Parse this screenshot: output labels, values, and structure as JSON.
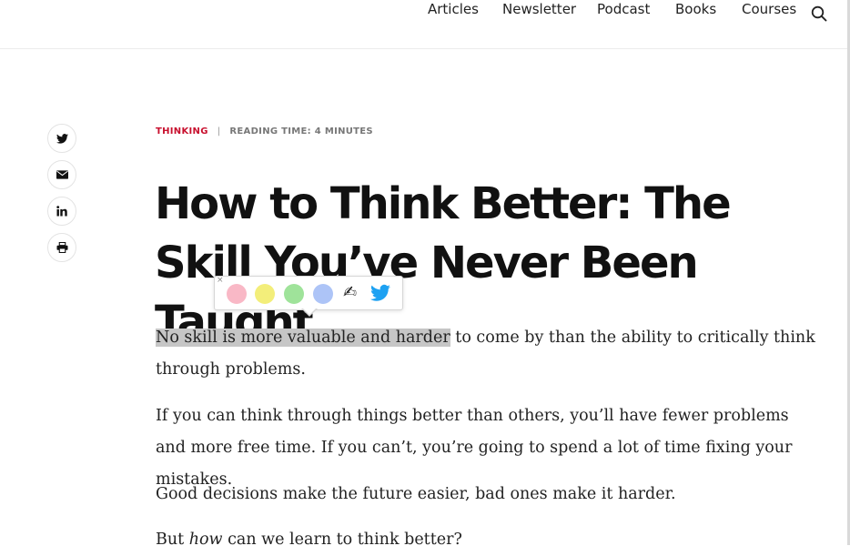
{
  "nav": {
    "items": [
      "Articles",
      "Newsletter",
      "Podcast",
      "Books",
      "Courses"
    ],
    "search_icon": "search-icon"
  },
  "share": {
    "icons": [
      "twitter-icon",
      "email-icon",
      "linkedin-icon",
      "print-icon"
    ]
  },
  "meta": {
    "category": "THINKING",
    "separator": "|",
    "reading_label": "READING TIME:",
    "reading_value": "4 MINUTES"
  },
  "article": {
    "title": "How to Think Better: The Skill You’ve Never Been Taught",
    "p1_selected": "No skill is more valuable and harder",
    "p1_rest": " to come by than the ability to critically think through problems.",
    "p2": "If you can think through things better than others, you’ll have fewer problems and more free time. If you can’t, you’re going to spend a lot of time fixing your mistakes.",
    "p3": "Good decisions make the future easier, bad ones make it harder.",
    "p4_before": "But ",
    "p4_em": "how",
    "p4_after": " can we learn to think better?"
  },
  "highlighter": {
    "close": "×",
    "colors": [
      "#f9b8c6",
      "#f3ee7a",
      "#9fe39a",
      "#adc4f7"
    ],
    "pencil": "✍",
    "icons": [
      "pencil-icon",
      "twitter-icon"
    ]
  },
  "colors": {
    "accent": "#c8102e",
    "twitter": "#1da1f2",
    "selection": "#c6c6c6"
  }
}
